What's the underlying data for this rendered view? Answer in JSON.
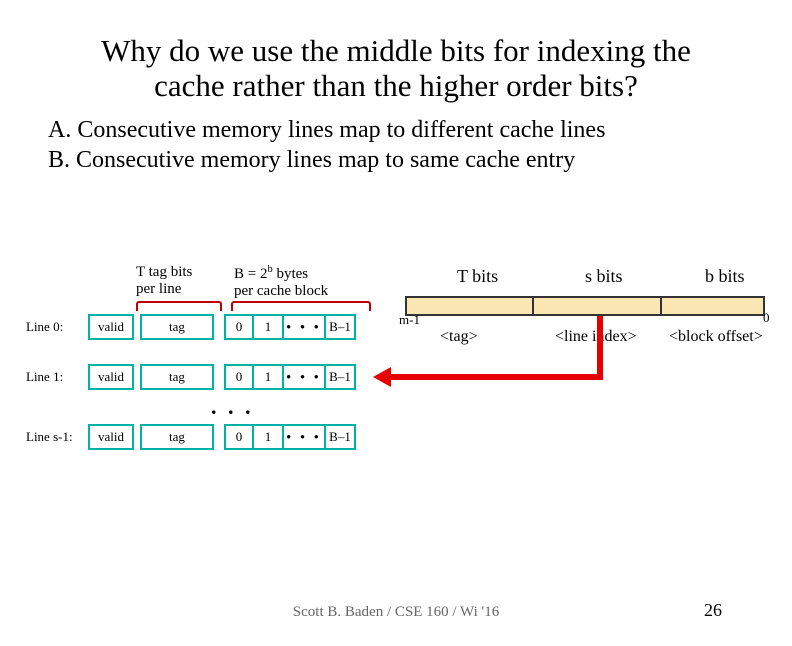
{
  "title_line1": "Why do we use the middle bits for indexing the",
  "title_line2": "cache rather than the higher order bits?",
  "optA_letter": "A.",
  "optA_text": "Consecutive memory lines map to different cache  lines",
  "optB_letter": "B.",
  "optB_text": "Consecutive memory lines map to same cache  entry",
  "caption_tagbits_l1": "T tag bits",
  "caption_tagbits_l2": "per line",
  "caption_block_l1_prefix": "B = 2",
  "caption_block_l1_sup": "b",
  "caption_block_l1_suffix": " bytes",
  "caption_block_l2": "per cache block",
  "line0_label": "Line 0:",
  "line1_label": "Line 1:",
  "lineS_label": "Line s-1:",
  "valid": "valid",
  "tag": "tag",
  "blk0": "0",
  "blk1": "1",
  "blkdots": "• • •",
  "blkB": "B–1",
  "vdots": ". . .",
  "t_cap": "T bits",
  "s_cap": "s bits",
  "b_cap": "b bits",
  "m1": "m-1",
  "zero": "0",
  "lbl_tag": "<tag>",
  "lbl_idx": "<line index>",
  "lbl_off": "<block offset>",
  "footer": "Scott B. Baden / CSE 160 / Wi '16",
  "pagenum": "26"
}
